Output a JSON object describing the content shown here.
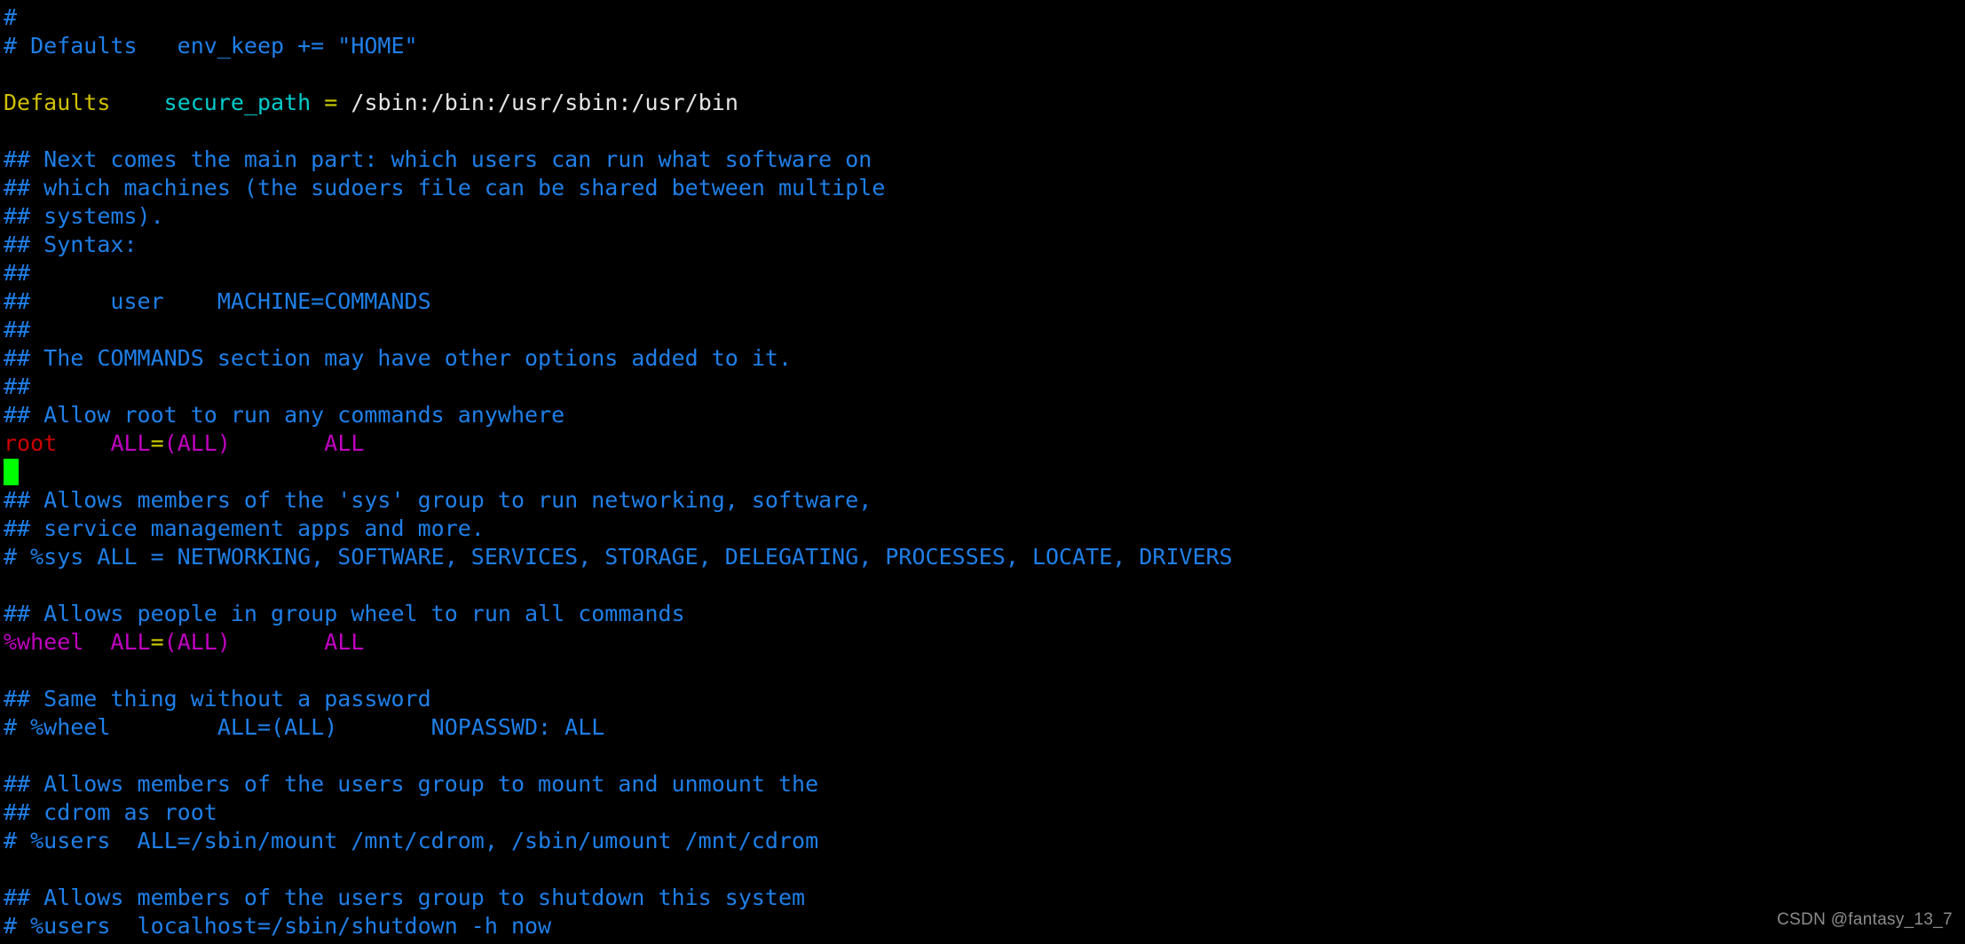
{
  "app": {
    "type": "terminal",
    "title": "sudoers file editor",
    "background_color": "#000000"
  },
  "colors": {
    "comment": "#1f7fe8",
    "keyword": "#cfc000",
    "param": "#00cdcd",
    "operator": "#cdcd00",
    "path": "#e6e6e6",
    "user": "#cc0000",
    "group": "#c000c0",
    "alias": "#c000c0",
    "cursor": "#00ff00",
    "watermark": "#8c8c8c"
  },
  "cursor": {
    "line_index": 17,
    "column": 0,
    "shape": "block"
  },
  "watermark": {
    "text": "CSDN @fantasy_13_7"
  },
  "terminal": {
    "lines": [
      {
        "index": 0,
        "text": "#",
        "tokens": [
          {
            "t": "#",
            "c": "comment"
          }
        ]
      },
      {
        "index": 1,
        "text": "# Defaults   env_keep += \"HOME\"",
        "tokens": [
          {
            "t": "# Defaults   env_keep += \"HOME\"",
            "c": "comment"
          }
        ]
      },
      {
        "index": 2,
        "text": "",
        "tokens": []
      },
      {
        "index": 3,
        "text": "Defaults    secure_path = /sbin:/bin:/usr/sbin:/usr/bin",
        "tokens": [
          {
            "t": "Defaults",
            "c": "keyword"
          },
          {
            "t": "    ",
            "c": "path"
          },
          {
            "t": "secure_path",
            "c": "param"
          },
          {
            "t": " ",
            "c": "path"
          },
          {
            "t": "=",
            "c": "operator"
          },
          {
            "t": " ",
            "c": "path"
          },
          {
            "t": "/sbin:/bin:/usr/sbin:/usr/bin",
            "c": "path"
          }
        ]
      },
      {
        "index": 4,
        "text": "",
        "tokens": []
      },
      {
        "index": 5,
        "text": "## Next comes the main part: which users can run what software on",
        "tokens": [
          {
            "t": "## Next comes the main part: which users can run what software on",
            "c": "comment"
          }
        ]
      },
      {
        "index": 6,
        "text": "## which machines (the sudoers file can be shared between multiple",
        "tokens": [
          {
            "t": "## which machines (the sudoers file can be shared between multiple",
            "c": "comment"
          }
        ]
      },
      {
        "index": 7,
        "text": "## systems).",
        "tokens": [
          {
            "t": "## systems).",
            "c": "comment"
          }
        ]
      },
      {
        "index": 8,
        "text": "## Syntax:",
        "tokens": [
          {
            "t": "## Syntax:",
            "c": "comment"
          }
        ]
      },
      {
        "index": 9,
        "text": "##",
        "tokens": [
          {
            "t": "##",
            "c": "comment"
          }
        ]
      },
      {
        "index": 10,
        "text": "##      user    MACHINE=COMMANDS",
        "tokens": [
          {
            "t": "##      user    MACHINE=COMMANDS",
            "c": "comment"
          }
        ]
      },
      {
        "index": 11,
        "text": "##",
        "tokens": [
          {
            "t": "##",
            "c": "comment"
          }
        ]
      },
      {
        "index": 12,
        "text": "## The COMMANDS section may have other options added to it.",
        "tokens": [
          {
            "t": "## The COMMANDS section may have other options added to it.",
            "c": "comment"
          }
        ]
      },
      {
        "index": 13,
        "text": "##",
        "tokens": [
          {
            "t": "##",
            "c": "comment"
          }
        ]
      },
      {
        "index": 14,
        "text": "## Allow root to run any commands anywhere",
        "tokens": [
          {
            "t": "## Allow root to run any commands anywhere",
            "c": "comment"
          }
        ]
      },
      {
        "index": 15,
        "text": "root    ALL=(ALL)       ALL",
        "tokens": [
          {
            "t": "root",
            "c": "user"
          },
          {
            "t": "    ",
            "c": "path"
          },
          {
            "t": "ALL",
            "c": "alias"
          },
          {
            "t": "=",
            "c": "operator"
          },
          {
            "t": "(ALL)",
            "c": "alias"
          },
          {
            "t": "       ",
            "c": "path"
          },
          {
            "t": "ALL",
            "c": "alias"
          }
        ]
      },
      {
        "index": 16,
        "text": "",
        "tokens": [],
        "cursor": true
      },
      {
        "index": 17,
        "text": "## Allows members of the 'sys' group to run networking, software,",
        "tokens": [
          {
            "t": "## Allows members of the 'sys' group to run networking, software,",
            "c": "comment"
          }
        ]
      },
      {
        "index": 18,
        "text": "## service management apps and more.",
        "tokens": [
          {
            "t": "## service management apps and more.",
            "c": "comment"
          }
        ]
      },
      {
        "index": 19,
        "text": "# %sys ALL = NETWORKING, SOFTWARE, SERVICES, STORAGE, DELEGATING, PROCESSES, LOCATE, DRIVERS",
        "tokens": [
          {
            "t": "# %sys ALL = NETWORKING, SOFTWARE, SERVICES, STORAGE, DELEGATING, PROCESSES, LOCATE, DRIVERS",
            "c": "comment"
          }
        ]
      },
      {
        "index": 20,
        "text": "",
        "tokens": []
      },
      {
        "index": 21,
        "text": "## Allows people in group wheel to run all commands",
        "tokens": [
          {
            "t": "## Allows people in group wheel to run all commands",
            "c": "comment"
          }
        ]
      },
      {
        "index": 22,
        "text": "%wheel  ALL=(ALL)       ALL",
        "tokens": [
          {
            "t": "%wheel",
            "c": "group"
          },
          {
            "t": "  ",
            "c": "path"
          },
          {
            "t": "ALL",
            "c": "alias"
          },
          {
            "t": "=",
            "c": "operator"
          },
          {
            "t": "(ALL)",
            "c": "alias"
          },
          {
            "t": "       ",
            "c": "path"
          },
          {
            "t": "ALL",
            "c": "alias"
          }
        ]
      },
      {
        "index": 23,
        "text": "",
        "tokens": []
      },
      {
        "index": 24,
        "text": "## Same thing without a password",
        "tokens": [
          {
            "t": "## Same thing without a password",
            "c": "comment"
          }
        ]
      },
      {
        "index": 25,
        "text": "# %wheel        ALL=(ALL)       NOPASSWD: ALL",
        "tokens": [
          {
            "t": "# %wheel        ALL=(ALL)       NOPASSWD: ALL",
            "c": "comment"
          }
        ]
      },
      {
        "index": 26,
        "text": "",
        "tokens": []
      },
      {
        "index": 27,
        "text": "## Allows members of the users group to mount and unmount the",
        "tokens": [
          {
            "t": "## Allows members of the users group to mount and unmount the",
            "c": "comment"
          }
        ]
      },
      {
        "index": 28,
        "text": "## cdrom as root",
        "tokens": [
          {
            "t": "## cdrom as root",
            "c": "comment"
          }
        ]
      },
      {
        "index": 29,
        "text": "# %users  ALL=/sbin/mount /mnt/cdrom, /sbin/umount /mnt/cdrom",
        "tokens": [
          {
            "t": "# %users  ALL=/sbin/mount /mnt/cdrom, /sbin/umount /mnt/cdrom",
            "c": "comment"
          }
        ]
      },
      {
        "index": 30,
        "text": "",
        "tokens": []
      },
      {
        "index": 31,
        "text": "## Allows members of the users group to shutdown this system",
        "tokens": [
          {
            "t": "## Allows members of the users group to shutdown this system",
            "c": "comment"
          }
        ]
      },
      {
        "index": 32,
        "text": "# %users  localhost=/sbin/shutdown -h now",
        "tokens": [
          {
            "t": "# %users  localhost=/sbin/shutdown -h now",
            "c": "comment"
          }
        ]
      }
    ]
  }
}
